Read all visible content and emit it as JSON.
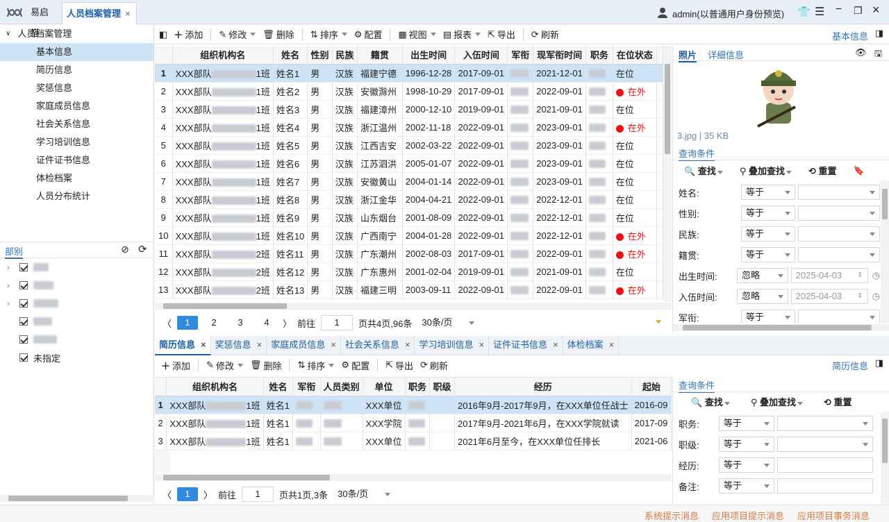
{
  "app": {
    "logo_text": "易启搭",
    "active_tab": "人员档案管理",
    "user": "admin(以普通用户身份预览)"
  },
  "colors": {
    "accent": "#2f8ae0",
    "selected_row": "#cfe3f7",
    "status_out": "#e11111",
    "footer_msg": "#e07a3a"
  },
  "left_tree": {
    "root": "人员档案管理",
    "items": [
      "基本信息",
      "简历信息",
      "奖惩信息",
      "家庭成员信息",
      "社会关系信息",
      "学习培训信息",
      "证件证书信息",
      "体检档案",
      "人员分布统计"
    ],
    "selected_index": 0
  },
  "dept": {
    "title": "部别",
    "items": [
      {
        "label": "",
        "expand": true
      },
      {
        "label": "",
        "expand": true
      },
      {
        "label": "",
        "expand": true
      },
      {
        "label": "",
        "expand": false
      },
      {
        "label": "",
        "expand": false
      },
      {
        "label": "未指定",
        "expand": false
      }
    ]
  },
  "main_toolbar": {
    "add": "添加",
    "edit": "修改",
    "delete": "删除",
    "sort": "排序",
    "config": "配置",
    "view": "视图",
    "report": "报表",
    "export": "导出",
    "refresh": "刷新",
    "right_label": "基本信息"
  },
  "main_table": {
    "columns": [
      "组织机构名",
      "姓名",
      "性别",
      "民族",
      "籍贯",
      "出生时间",
      "入伍时间",
      "军衔",
      "现军衔时间",
      "职务",
      "在位状态"
    ],
    "rows": [
      {
        "no": "1",
        "org": "XXX部队",
        "org_end": "1班",
        "name": "姓名1",
        "sex": "男",
        "nation": "汉族",
        "origin": "福建宁德",
        "birth": "1996-12-28",
        "enlist": "2017-09-01",
        "rank_time": "2021-12-01",
        "status": "在位",
        "out": false
      },
      {
        "no": "2",
        "org": "XXX部队",
        "org_end": "1班",
        "name": "姓名2",
        "sex": "男",
        "nation": "汉族",
        "origin": "安徽滁州",
        "birth": "1998-10-29",
        "enlist": "2017-09-01",
        "rank_time": "2022-09-01",
        "status": "在外",
        "out": true
      },
      {
        "no": "3",
        "org": "XXX部队",
        "org_end": "1班",
        "name": "姓名3",
        "sex": "男",
        "nation": "汉族",
        "origin": "福建漳州",
        "birth": "2000-12-10",
        "enlist": "2019-09-01",
        "rank_time": "2021-09-01",
        "status": "在位",
        "out": false
      },
      {
        "no": "4",
        "org": "XXX部队",
        "org_end": "1班",
        "name": "姓名4",
        "sex": "男",
        "nation": "汉族",
        "origin": "浙江温州",
        "birth": "2002-11-18",
        "enlist": "2022-09-01",
        "rank_time": "2023-09-01",
        "status": "在外",
        "out": true
      },
      {
        "no": "5",
        "org": "XXX部队",
        "org_end": "1班",
        "name": "姓名5",
        "sex": "男",
        "nation": "汉族",
        "origin": "江西吉安",
        "birth": "2002-03-22",
        "enlist": "2022-09-01",
        "rank_time": "2023-09-01",
        "status": "在位",
        "out": false
      },
      {
        "no": "6",
        "org": "XXX部队",
        "org_end": "1班",
        "name": "姓名6",
        "sex": "男",
        "nation": "汉族",
        "origin": "江苏泗洪",
        "birth": "2005-01-07",
        "enlist": "2022-09-01",
        "rank_time": "2023-09-01",
        "status": "在位",
        "out": false
      },
      {
        "no": "7",
        "org": "XXX部队",
        "org_end": "1班",
        "name": "姓名7",
        "sex": "男",
        "nation": "汉族",
        "origin": "安徽黄山",
        "birth": "2004-01-14",
        "enlist": "2022-09-01",
        "rank_time": "2023-09-01",
        "status": "在位",
        "out": false
      },
      {
        "no": "8",
        "org": "XXX部队",
        "org_end": "1班",
        "name": "姓名8",
        "sex": "男",
        "nation": "汉族",
        "origin": "浙江金华",
        "birth": "2004-04-21",
        "enlist": "2022-09-01",
        "rank_time": "2022-12-01",
        "status": "在位",
        "out": false
      },
      {
        "no": "9",
        "org": "XXX部队",
        "org_end": "1班",
        "name": "姓名9",
        "sex": "男",
        "nation": "汉族",
        "origin": "山东烟台",
        "birth": "2001-08-09",
        "enlist": "2022-09-01",
        "rank_time": "2022-12-01",
        "status": "在位",
        "out": false
      },
      {
        "no": "10",
        "org": "XXX部队",
        "org_end": "1班",
        "name": "姓名10",
        "sex": "男",
        "nation": "汉族",
        "origin": "广西南宁",
        "birth": "2004-01-28",
        "enlist": "2022-09-01",
        "rank_time": "2022-12-01",
        "status": "在外",
        "out": true
      },
      {
        "no": "11",
        "org": "XXX部队",
        "org_end": "2班",
        "name": "姓名11",
        "sex": "男",
        "nation": "汉族",
        "origin": "广东潮州",
        "birth": "2002-08-03",
        "enlist": "2017-09-01",
        "rank_time": "2022-09-01",
        "status": "在外",
        "out": true
      },
      {
        "no": "12",
        "org": "XXX部队",
        "org_end": "2班",
        "name": "姓名12",
        "sex": "男",
        "nation": "汉族",
        "origin": "广东惠州",
        "birth": "2001-02-04",
        "enlist": "2019-09-01",
        "rank_time": "2021-09-01",
        "status": "在位",
        "out": false
      },
      {
        "no": "13",
        "org": "XXX部队",
        "org_end": "2班",
        "name": "姓名13",
        "sex": "男",
        "nation": "汉族",
        "origin": "福建三明",
        "birth": "2003-09-11",
        "enlist": "2022-09-01",
        "rank_time": "2022-09-01",
        "status": "在外",
        "out": true
      }
    ]
  },
  "main_pager": {
    "pages": [
      "1",
      "2",
      "3",
      "4"
    ],
    "goto": "前往",
    "goto_value": "1",
    "total": "页共4页,96条",
    "size": "30条/页"
  },
  "photo_panel": {
    "tab_photo": "照片",
    "tab_detail": "详细信息",
    "file_info": "3.jpg | 35 KB",
    "query_title": "查询条件",
    "find": "查找",
    "add_find": "叠加查找",
    "reset": "重置"
  },
  "query_main": [
    {
      "label": "姓名:",
      "op": "等于",
      "value": ""
    },
    {
      "label": "性别:",
      "op": "等于",
      "value": ""
    },
    {
      "label": "民族:",
      "op": "等于",
      "value": ""
    },
    {
      "label": "籍贯:",
      "op": "等于",
      "value": ""
    },
    {
      "label": "出生时间:",
      "op": "忽略",
      "value": "2025-04-03"
    },
    {
      "label": "入伍时间:",
      "op": "忽略",
      "value": "2025-04-03"
    },
    {
      "label": "军衔:",
      "op": "等于",
      "value": ""
    }
  ],
  "sub_tabs": [
    "简历信息",
    "奖惩信息",
    "家庭成员信息",
    "社会关系信息",
    "学习培训信息",
    "证件证书信息",
    "体检档案"
  ],
  "sub_toolbar": {
    "add": "添加",
    "edit": "修改",
    "delete": "删除",
    "sort": "排序",
    "config": "配置",
    "export": "导出",
    "refresh": "刷新",
    "right_label": "简历信息"
  },
  "sub_table": {
    "columns": [
      "组织机构名",
      "姓名",
      "军衔",
      "人员类别",
      "单位",
      "职务",
      "职级",
      "经历",
      "起始"
    ],
    "rows": [
      {
        "no": "1",
        "org": "XXX部队",
        "org_end": "1班",
        "name": "姓名1",
        "unit": "XXX单位",
        "exp": "2016年9月-2017年9月，在XXX单位任战士",
        "start": "2016-09"
      },
      {
        "no": "2",
        "org": "XXX部队",
        "org_end": "1班",
        "name": "姓名1",
        "unit": "XXX学院",
        "exp": "2017年9月-2021年6月，在XXX学院就读",
        "start": "2017-09"
      },
      {
        "no": "3",
        "org": "XXX部队",
        "org_end": "1班",
        "name": "姓名1",
        "unit": "XXX单位",
        "exp": "2021年6月至今，在XXX单位任排长",
        "start": "2021-06"
      }
    ]
  },
  "sub_pager": {
    "page": "1",
    "goto": "前往",
    "goto_value": "1",
    "total": "页共1页,3条",
    "size": "30条/页"
  },
  "sub_query": {
    "title": "查询条件",
    "find": "查找",
    "add_find": "叠加查找",
    "reset": "重置",
    "rows": [
      {
        "label": "职务:",
        "op": "等于"
      },
      {
        "label": "职级:",
        "op": "等于"
      },
      {
        "label": "经历:",
        "op": "等于"
      },
      {
        "label": "备注:",
        "op": "等于"
      }
    ]
  },
  "footer": {
    "m1": "系统提示消息",
    "m2": "应用项目提示消息",
    "m3": "应用项目事务消息"
  }
}
